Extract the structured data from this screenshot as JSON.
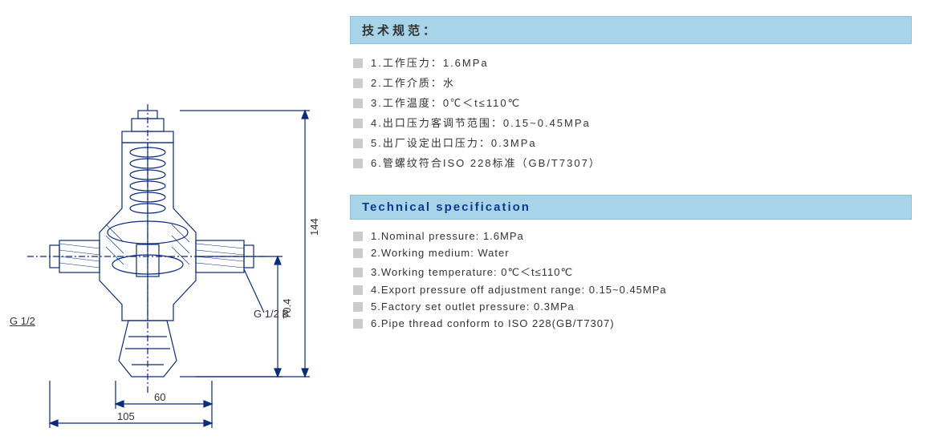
{
  "diagram": {
    "thread_left": "G 1/2",
    "thread_right": "G 1/2 B",
    "dim_height_total": "144",
    "dim_height_lower": "70.4",
    "dim_width_inner": "60",
    "dim_width_total": "105"
  },
  "spec_cn": {
    "header": "技术规范：",
    "items": [
      "1.工作压力：1.6MPa",
      "2.工作介质：水",
      "3.工作温度：0℃＜t≤110℃",
      "4.出口压力客调节范围：0.15~0.45MPa",
      "5.出厂设定出口压力：0.3MPa",
      "6.管螺纹符合ISO 228标准（GB/T7307）"
    ]
  },
  "spec_en": {
    "header": "Technical specification",
    "items": [
      "1.Nominal pressure: 1.6MPa",
      "2.Working medium: Water",
      "3.Working temperature: 0℃＜t≤110℃",
      "4.Export pressure off adjustment range: 0.15~0.45MPa",
      "5.Factory set outlet pressure: 0.3MPa",
      "6.Pipe thread conform to ISO 228(GB/T7307)"
    ]
  }
}
